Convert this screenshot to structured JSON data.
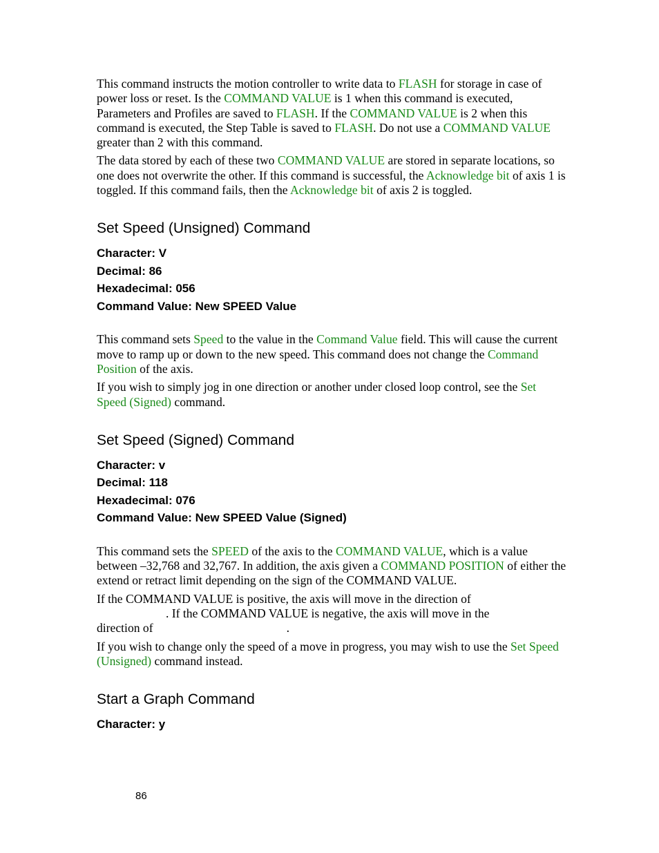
{
  "intro": {
    "p1": {
      "t1": "This command instructs the motion controller to write data to ",
      "l1": "FLASH",
      "t2": " for storage in case of power loss or reset.  Is the ",
      "l2": "COMMAND VALUE",
      "t3": " is 1 when this command is executed, Parameters and Profiles are saved to ",
      "l3": "FLASH",
      "t4": ".  If the ",
      "l4": "COMMAND VALUE",
      "t5": " is 2 when this command is executed, the Step Table is saved to ",
      "l5": "FLASH",
      "t6": ".  Do not use a ",
      "l6": "COMMAND VALUE",
      "t7": " greater than 2 with this command."
    },
    "p2": {
      "t1": "The data stored by each of these two ",
      "l1": "COMMAND VALUE",
      "t2": " are stored in separate locations, so one does not overwrite the other.  If this command is successful, the ",
      "l2": "Acknowledge bit",
      "t3": " of axis 1 is toggled.  If this command fails, then the ",
      "l3": "Acknowledge bit",
      "t4": " of axis 2 is toggled."
    }
  },
  "set_speed_unsigned": {
    "heading": "Set Speed (Unsigned) Command",
    "specs": [
      "Character: V",
      "Decimal: 86",
      "Hexadecimal: 056",
      "Command Value: New SPEED Value"
    ],
    "p1": {
      "t1": "This command sets ",
      "l1": "Speed",
      "t2": " to the value in the ",
      "l2": "Command Value",
      "t3": " field.  This will cause the current move to ramp up or down to the new speed.  This command does not change the ",
      "l3": "Command Position",
      "t4": " of the axis."
    },
    "p2": {
      "t1": "If you wish to simply jog in one direction or another under closed loop control, see the ",
      "l1": "Set Speed (Signed)",
      "t2": " command."
    }
  },
  "set_speed_signed": {
    "heading": "Set Speed (Signed) Command",
    "specs": [
      "Character: v",
      "Decimal: 118",
      "Hexadecimal: 076",
      "Command Value: New SPEED Value (Signed)"
    ],
    "p1": {
      "t1": "This command sets the ",
      "l1": "SPEED",
      "t2": " of the axis to the ",
      "l2": "COMMAND VALUE",
      "t3": ", which is a value between –32,768 and 32,767.  In addition, the axis given a ",
      "l3": "COMMAND POSITION",
      "t4": " of either the extend or retract limit depending on the sign of the COMMAND VALUE."
    },
    "p2": {
      "line1": "If the COMMAND VALUE is positive, the axis will move in the direction of",
      "line2": ".  If the COMMAND VALUE is negative, the axis will move in the",
      "line3": "direction of",
      "line3_end": "."
    },
    "p3": {
      "t1": "If you wish to change only the speed of a move in progress, you may wish to use the ",
      "l1": "Set Speed (Unsigned)",
      "t2": " command instead."
    }
  },
  "start_graph": {
    "heading": "Start a Graph Command",
    "specs": [
      "Character: y"
    ]
  },
  "footer": {
    "page_number": "86"
  },
  "colors": {
    "link": "#1a8a1a",
    "text": "#000000"
  }
}
